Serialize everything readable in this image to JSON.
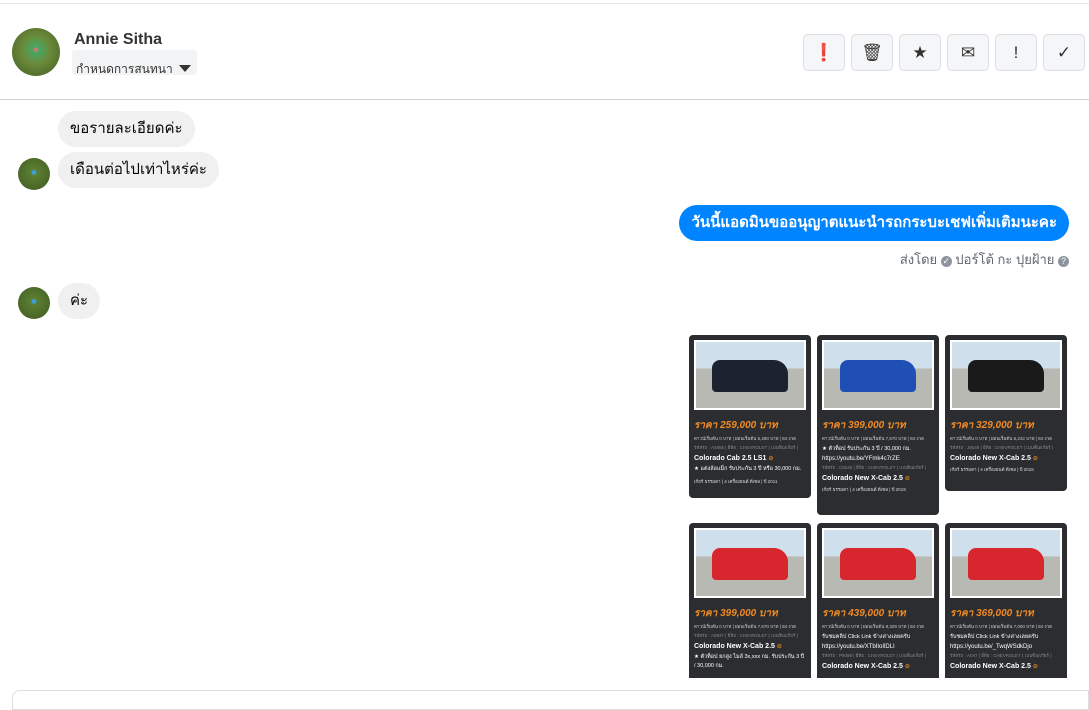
{
  "header": {
    "contact_name": "Annie Sitha",
    "conversation_menu_label": "กำหนดการสนทนา",
    "actions": [
      {
        "name": "spam",
        "glyph": "❗"
      },
      {
        "name": "delete",
        "glyph": "🗑"
      },
      {
        "name": "star",
        "glyph": "★"
      },
      {
        "name": "mark-unread",
        "glyph": "✉"
      },
      {
        "name": "important",
        "glyph": "!"
      },
      {
        "name": "done",
        "glyph": "✓"
      }
    ]
  },
  "messages": [
    {
      "from": "contact",
      "text": "ขอรายละเอียดค่ะ"
    },
    {
      "from": "contact",
      "text": "เดือนต่อไปเท่าไหร่ค่ะ"
    },
    {
      "from": "page",
      "text": "วันนี้แอดมินขออนุญาตแนะนำรถกระบะเชฟเพิ่มเติมนะคะ"
    },
    {
      "from": "contact",
      "text": "ค่ะ"
    }
  ],
  "sent_by": {
    "label": "ส่งโดย",
    "name": "ปอร์โต้ กะ ปุยฝ้าย",
    "help": "?"
  },
  "cards": [
    {
      "price": "ราคา 259,000 บาท",
      "terms": "ดาวน์เริ่มต้น 0 บาท | ผ่อนเริ่มต้น 5,280 บาท | 84 งวด",
      "tag": "รหัสรถ : A4865 | ยี่ห้อ : CHEVROLET ( เบนซิน/เกียร์ )",
      "title": "Colorado Cab 2.5 LS1",
      "desc": "★ แต่งล้อแม็ก รับประกัน 3 ปี หรือ 30,000 กม.",
      "link": "",
      "foot": "เกียร์ ธรรมดา | 4 เครื่องยนต์ ดีเซล | ปี 2011",
      "color": "#1d2230"
    },
    {
      "price": "ราคา 399,000 บาท",
      "terms": "ดาวน์เริ่มต้น 0 บาท | ผ่อนเริ่มต้น 7,570 บาท | 84 งวด",
      "tag": "รหัสรถ : C8245 | ยี่ห้อ : CHEVROLET ( เบนซิน/เกียร์ )",
      "title": "Colorado New X-Cab 2.5",
      "desc": "★ ตัวท็อป รับประกัน 3 ปี / 30,000 กม.",
      "link": "https://youtu.be/YFmk4c7rZE",
      "foot": "เกียร์ ธรรมดา | 4 เครื่องยนต์ ดีเซล | ปี 2019",
      "color": "#1f4fb5"
    },
    {
      "price": "ราคา 329,000 บาท",
      "terms": "ดาวน์เริ่มต้น 0 บาท | ผ่อนเริ่มต้น 6,242 บาท | 84 งวด",
      "tag": "รหัสรถ : J8049 | ยี่ห้อ : CHEVROLET ( เบนซิน/เกียร์ )",
      "title": "Colorado New X-Cab 2.5",
      "desc": "",
      "link": "",
      "foot": "เกียร์ ธรรมดา | 4 เครื่องยนต์ ดีเซล | ปี 2015",
      "color": "#1a1a1a"
    },
    {
      "price": "ราคา 399,000 บาท",
      "terms": "ดาวน์เริ่มต้น 0 บาท | ผ่อนเริ่มต้น 7,570 บาท | 84 งวด",
      "tag": "รหัสรถ : A8937 | ยี่ห้อ : CHEVROLET ( เบนซิน/เกียร์ )",
      "title": "Colorado New X-Cab 2.5",
      "desc": "★ ตัวท็อป ยกสูง ไมล์ 3x,xxx กม. รับประกัน 3 ปี / 30,000 กม.",
      "link": "",
      "foot": "",
      "color": "#d8262e"
    },
    {
      "price": "ราคา 439,000 บาท",
      "terms": "ดาวน์เริ่มต้น 0 บาท | ผ่อนเริ่มต้น 8,329 บาท | 84 งวด",
      "tag": "รหัสรถ : P8089 | ยี่ห้อ : CHEVROLET ( เบนซิน/เกียร์ )",
      "title": "Colorado New X-Cab 2.5",
      "desc": "รับชมคลิป Click Link ข้างล่างเลยครับ",
      "link": "https://youtu.be/XTbIIoIlDLI",
      "foot": "",
      "color": "#d8262e"
    },
    {
      "price": "ราคา 369,000 บาท",
      "terms": "ดาวน์เริ่มต้น 0 บาท | ผ่อนเริ่มต้น 7,000 บาท | 84 งวด",
      "tag": "รหัสรถ : A047 | ยี่ห้อ : CHEVROLET ( เบนซิน/เกียร์ )",
      "title": "Colorado New X-Cab 2.5",
      "desc": "รับชมคลิป Click Link ข้างล่างเลยครับ",
      "link": "https://youtu.be/_TwqWSdkDjo",
      "foot": "",
      "color": "#d8262e"
    }
  ]
}
